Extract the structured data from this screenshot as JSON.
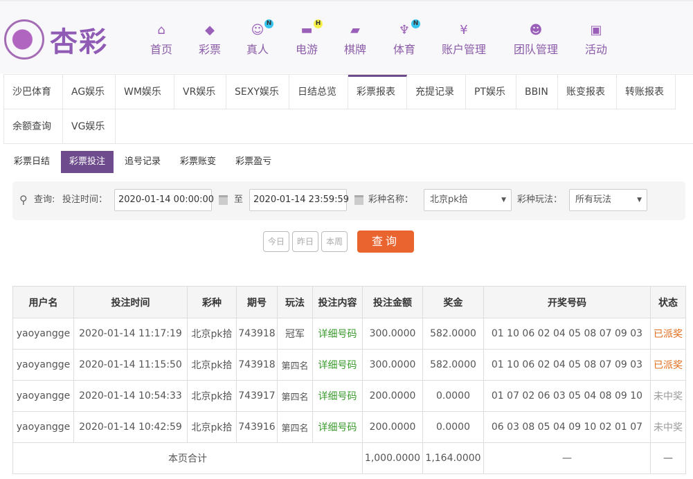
{
  "logo": {
    "text": "杏彩"
  },
  "nav": [
    {
      "label": "首页",
      "icon": "home-icon",
      "glyph": "⌂"
    },
    {
      "label": "彩票",
      "icon": "ticket-icon",
      "glyph": "◆"
    },
    {
      "label": "真人",
      "icon": "dealer-icon",
      "glyph": "☺",
      "badge": "N",
      "badge_color": "#37c4ee"
    },
    {
      "label": "电游",
      "icon": "gamepad-icon",
      "glyph": "▬",
      "badge": "H",
      "badge_color": "#f5f04a"
    },
    {
      "label": "棋牌",
      "icon": "cards-icon",
      "glyph": "▰"
    },
    {
      "label": "体育",
      "icon": "trophy-icon",
      "glyph": "♆",
      "badge": "N",
      "badge_color": "#37c4ee"
    },
    {
      "label": "账户管理",
      "icon": "yen-icon",
      "glyph": "¥"
    },
    {
      "label": "团队管理",
      "icon": "team-icon",
      "glyph": "☻"
    },
    {
      "label": "活动",
      "icon": "gift-icon",
      "glyph": "▣"
    }
  ],
  "tabs": [
    "沙巴体育",
    "AG娱乐",
    "WM娱乐",
    "VR娱乐",
    "SEXY娱乐",
    "日结总览",
    "彩票报表",
    "充提记录",
    "PT娱乐",
    "BBIN",
    "账变报表",
    "转账报表",
    "余额查询",
    "VG娱乐"
  ],
  "active_tab": "彩票报表",
  "subtabs": [
    "彩票日结",
    "彩票投注",
    "追号记录",
    "彩票账变",
    "彩票盈亏"
  ],
  "filter": {
    "query_label": "查询:",
    "time_label": "投注时间：",
    "start": "2020-01-14 00:00:00",
    "to": "至",
    "end": "2020-01-14 23:59:59",
    "lottery_label": "彩种名称：",
    "lottery": "北京pk拾",
    "play_label": "彩种玩法：",
    "play": "所有玩法"
  },
  "buttons": {
    "today": "今日",
    "yesterday": "昨日",
    "week": "本周",
    "query": "查询"
  },
  "table": {
    "headers": [
      "用户名",
      "投注时间",
      "彩种",
      "期号",
      "玩法",
      "投注内容",
      "投注金额",
      "奖金",
      "开奖号码",
      "状态"
    ],
    "rows": [
      [
        "yaoyangge",
        "2020-01-14 11:17:19",
        "北京pk拾",
        "743918",
        "冠军",
        "详细号码",
        "300.0000",
        "582.0000",
        "01 10 06 02 04 05 08 07 09 03",
        "已派奖"
      ],
      [
        "yaoyangge",
        "2020-01-14 11:15:50",
        "北京pk拾",
        "743918",
        "第四名",
        "详细号码",
        "300.0000",
        "582.0000",
        "01 10 06 02 04 05 08 07 09 03",
        "已派奖"
      ],
      [
        "yaoyangge",
        "2020-01-14 10:54:33",
        "北京pk拾",
        "743917",
        "第四名",
        "详细号码",
        "200.0000",
        "0.0000",
        "01 07 02 06 03 05 04 08 09 10",
        "未中奖"
      ],
      [
        "yaoyangge",
        "2020-01-14 10:42:59",
        "北京pk拾",
        "743916",
        "第四名",
        "详细号码",
        "200.0000",
        "0.0000",
        "06 03 08 05 04 09 10 02 01 07",
        "未中奖"
      ]
    ],
    "total": {
      "label": "本页合计",
      "amount": "1,000.0000",
      "prize": "1,164.0000",
      "numbers": "—",
      "status": "—"
    }
  }
}
